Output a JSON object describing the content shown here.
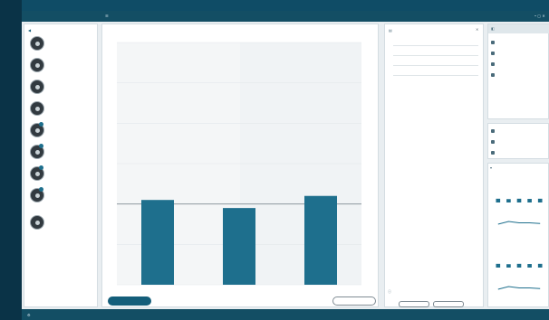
{
  "app": {
    "title": "",
    "project": "",
    "status": ""
  },
  "left_list": {
    "header": "",
    "items": [
      {
        "name": "",
        "sub": ""
      },
      {
        "name": "",
        "sub": ""
      },
      {
        "name": "",
        "sub": ""
      },
      {
        "name": "",
        "sub": ""
      },
      {
        "name": "",
        "sub": ""
      },
      {
        "name": "",
        "sub": ""
      },
      {
        "name": "",
        "sub": ""
      },
      {
        "name": "",
        "sub": ""
      },
      {
        "name": "",
        "sub": ""
      }
    ]
  },
  "main": {
    "breadcrumb": "",
    "chart_title": "",
    "primary_button": "",
    "secondary_button": ""
  },
  "chart_data": {
    "type": "bar",
    "title": "",
    "xlabel": "",
    "ylabel": "",
    "categories": [
      "",
      "",
      ""
    ],
    "values": [
      1.05,
      0.95,
      1.1
    ],
    "ylim": [
      0,
      3
    ],
    "reference_line": {
      "label": "",
      "value": 1.0
    },
    "grid": true,
    "bar_color": "#1e6f8d"
  },
  "stats": {
    "header": "",
    "table_header": [
      "",
      ""
    ],
    "rows": [
      [
        "",
        ""
      ],
      [
        "",
        ""
      ],
      [
        "",
        ""
      ]
    ],
    "label1": "",
    "value1": "",
    "label2": "",
    "value2": "",
    "btn1": "",
    "btn2": ""
  },
  "right": {
    "header": "",
    "items": [
      "",
      "",
      "",
      ""
    ],
    "lower_items": [
      "",
      "",
      ""
    ],
    "mini_header": "",
    "mini_charts": [
      {
        "title": "",
        "sub": "",
        "values": [
          1.0,
          0.9,
          1.0,
          0.95,
          1.0
        ]
      },
      {
        "title": "",
        "sub": "",
        "values": [
          0.8,
          1.0,
          0.9,
          0.9,
          0.85
        ]
      },
      {
        "title": "",
        "sub": "",
        "values": [
          1.0,
          0.9,
          1.0,
          0.95,
          1.0
        ]
      },
      {
        "title": "",
        "sub": "",
        "values": [
          0.8,
          1.0,
          0.9,
          0.9,
          0.85
        ]
      }
    ]
  },
  "colors": {
    "accent": "#145e7a",
    "bar": "#1e6f8d",
    "app_bar": "#134e64"
  }
}
